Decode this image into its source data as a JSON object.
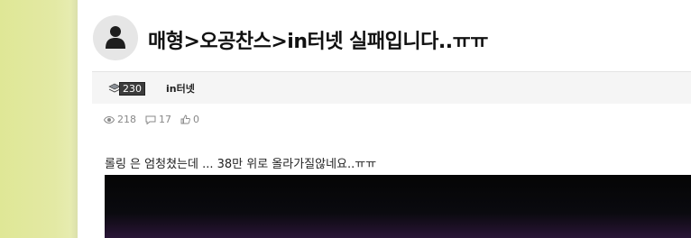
{
  "post": {
    "title": "매형>오공찬스>in터넷 실패입니다..ㅠㅠ",
    "author": {
      "level": "230",
      "name": "in터넷"
    },
    "stats": {
      "views": "218",
      "comments": "17",
      "likes": "0"
    },
    "body": "롤링 은 엄청쳤는데 ... 38만 위로 올라가질않네요..ㅠㅠ"
  },
  "icons": {
    "avatar": "user-avatar-icon",
    "level": "level-badge-icon",
    "views": "eye-icon",
    "comments": "comment-icon",
    "likes": "thumbs-up-icon"
  }
}
